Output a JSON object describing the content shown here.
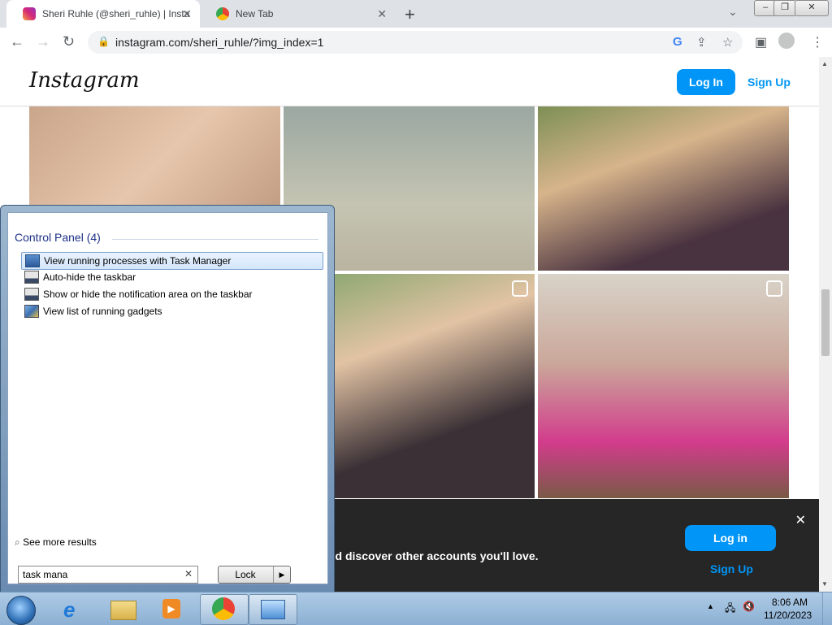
{
  "browser": {
    "tabs": [
      {
        "label": "Sheri Ruhle (@sheri_ruhle) | Insta",
        "active": true
      },
      {
        "label": "New Tab",
        "active": false
      }
    ],
    "url": "instagram.com/sheri_ruhle/?img_index=1"
  },
  "instagram": {
    "logo": "Instagram",
    "login_label": "Log In",
    "signup_label": "Sign Up"
  },
  "banner": {
    "text": "nd discover other accounts you'll love.",
    "login_label": "Log in",
    "signup_label": "Sign Up"
  },
  "start_menu": {
    "heading": "Control Panel (4)",
    "items": [
      {
        "label": "View running processes with Task Manager",
        "icon": "task-manager-icon"
      },
      {
        "label": "Auto-hide the taskbar",
        "icon": "taskbar-icon"
      },
      {
        "label": "Show or hide the notification area on the taskbar",
        "icon": "taskbar-icon"
      },
      {
        "label": "View list of running gadgets",
        "icon": "gadgets-icon"
      }
    ],
    "see_more": "See more results",
    "search_value": "task mana",
    "lock_label": "Lock"
  },
  "taskbar": {
    "time": "8:06 AM",
    "date": "11/20/2023"
  }
}
